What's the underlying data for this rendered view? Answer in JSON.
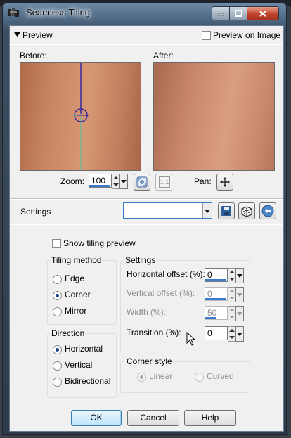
{
  "window": {
    "title": "Seamless Tiling",
    "accent": "#3a7ac8"
  },
  "preview": {
    "section_label": "Preview",
    "preview_on_image_label": "Preview on Image",
    "preview_on_image_checked": false,
    "before_label": "Before:",
    "after_label": "After:",
    "zoom_label": "Zoom:",
    "zoom_value": "100",
    "zoom_actual_label": "1:1",
    "pan_label": "Pan:"
  },
  "settings_bar": {
    "label": "Settings",
    "preset_value": ""
  },
  "show_tiling_preview": {
    "label": "Show tiling preview",
    "checked": false
  },
  "tiling_method": {
    "title": "Tiling method",
    "options": [
      {
        "label": "Edge",
        "selected": false
      },
      {
        "label": "Corner",
        "selected": true
      },
      {
        "label": "Mirror",
        "selected": false
      }
    ]
  },
  "direction": {
    "title": "Direction",
    "options": [
      {
        "label": "Horizontal",
        "selected": true
      },
      {
        "label": "Vertical",
        "selected": false
      },
      {
        "label": "Bidirectional",
        "selected": false
      }
    ]
  },
  "settings_group": {
    "title": "Settings",
    "fields": [
      {
        "label": "Horizontal offset (%):",
        "value": "0",
        "enabled": true
      },
      {
        "label": "Vertical offset (%):",
        "value": "0",
        "enabled": false
      },
      {
        "label": "Width (%):",
        "value": "50",
        "enabled": false
      },
      {
        "label": "Transition (%):",
        "value": "0",
        "enabled": true
      }
    ]
  },
  "corner_style": {
    "title": "Corner style",
    "options": [
      {
        "label": "Linear",
        "selected": true,
        "enabled": false
      },
      {
        "label": "Curved",
        "selected": false,
        "enabled": false
      }
    ]
  },
  "buttons": {
    "ok": "OK",
    "cancel": "Cancel",
    "help": "Help"
  }
}
